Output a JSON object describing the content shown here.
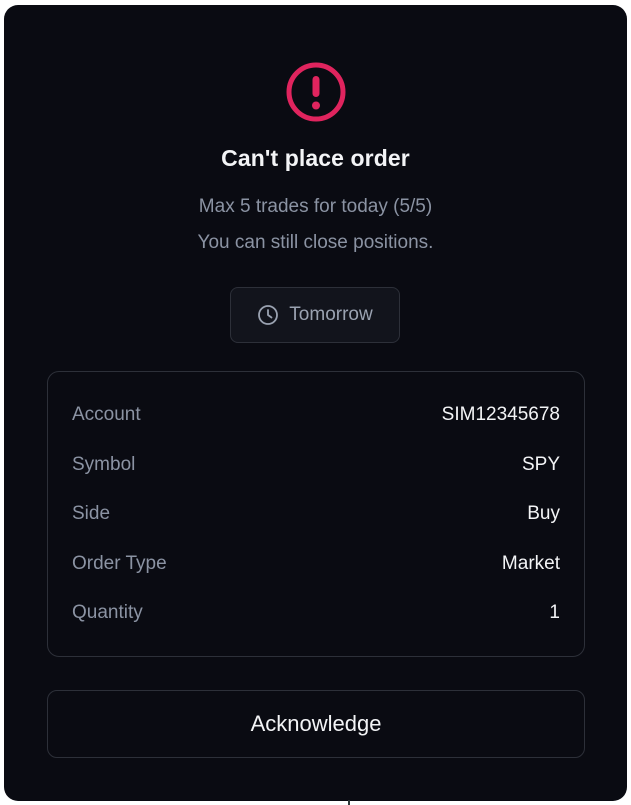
{
  "dialog": {
    "title": "Can't place order",
    "message_line1": "Max 5 trades for today (5/5)",
    "message_line2": "You can still close positions.",
    "reset_label": "Tomorrow",
    "icons": {
      "alert": "alert-circle-icon",
      "reset": "clock-icon"
    },
    "colors": {
      "background": "#0a0b12",
      "alert": "#e0245e",
      "text_primary": "#f3f4f6",
      "text_secondary": "#8b93a3",
      "border": "#2d3039"
    }
  },
  "order_details": [
    {
      "label": "Account",
      "value": "SIM12345678"
    },
    {
      "label": "Symbol",
      "value": "SPY"
    },
    {
      "label": "Side",
      "value": "Buy"
    },
    {
      "label": "Order Type",
      "value": "Market"
    },
    {
      "label": "Quantity",
      "value": "1"
    }
  ],
  "actions": {
    "acknowledge_label": "Acknowledge"
  }
}
